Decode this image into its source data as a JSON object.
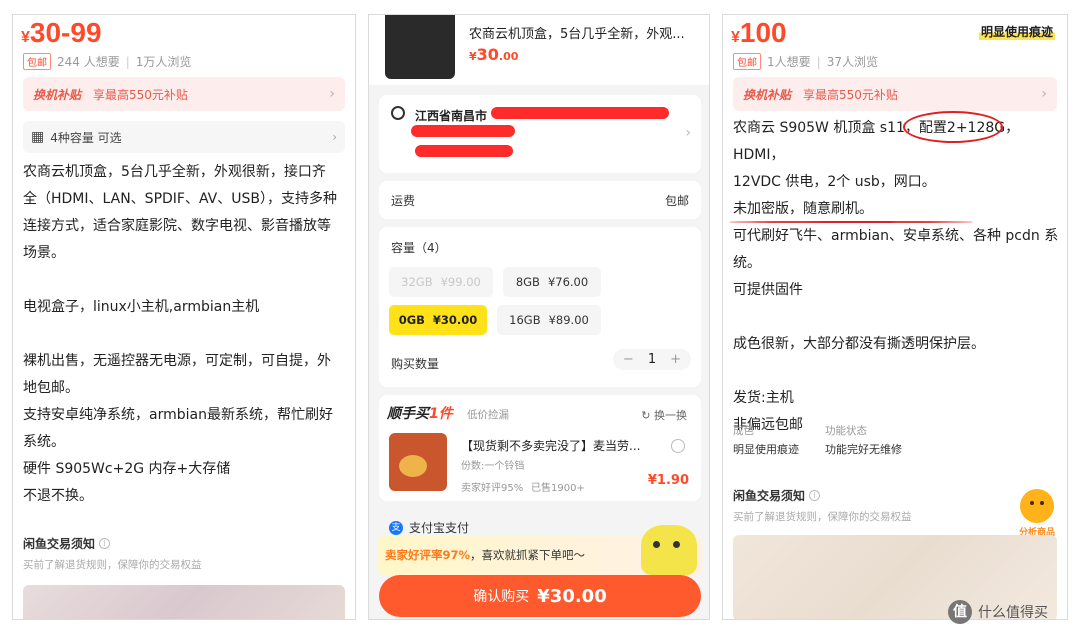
{
  "left": {
    "price_currency": "¥",
    "price_value": "30-99",
    "tag": "包邮",
    "wants": "244 人想要",
    "views": "1万人浏览",
    "subsidy_label": "换机补贴",
    "subsidy_text": "享最高550元补贴",
    "capacity_text": "4种容量 可选",
    "description": [
      "农商云机顶盒，5台几乎全新，外观很新，接口齐",
      "全（HDMI、LAN、SPDIF、AV、USB），支持多种",
      "连接方式，适合家庭影院、数字电视、影音播放等",
      "场景。",
      "",
      "电视盒子，linux小主机,armbian主机",
      "",
      "裸机出售，无遥控器无电源，可定制，可自提，外",
      "地包邮。",
      "支持安卓纯净系统，armbian最新系统，帮忙刷好",
      "系统。",
      "硬件 S905Wc+2G 内存+大存储",
      "不退不换。"
    ],
    "notice_title": "闲鱼交易须知",
    "notice_sub": "买前了解退货规则，保障你的交易权益"
  },
  "middle": {
    "item_title": "农商云机顶盒，5台几乎全新，外观...",
    "item_price_cur": "¥",
    "item_price": "30",
    "item_price_dec": ".00",
    "address": "江西省南昌市",
    "shipping_label": "运费",
    "shipping_value": "包邮",
    "capacity_label": "容量（4）",
    "options": [
      {
        "size": "32GB",
        "price": "¥99.00"
      },
      {
        "size": "8GB",
        "price": "¥76.00"
      },
      {
        "size": "0GB",
        "price": "¥30.00"
      },
      {
        "size": "16GB",
        "price": "¥89.00"
      }
    ],
    "qty_label": "购买数量",
    "qty_minus": "−",
    "qty_value": "1",
    "qty_plus": "+",
    "bundle_title_a": "顺手买",
    "bundle_title_b": "1件",
    "bundle_sub": "低价捡漏",
    "swap": "换一换",
    "bundle_item_title": "【现货剩不多卖完没了】麦当劳...",
    "bundle_item_spec": "份数:一个铃铛",
    "bundle_item_rate": "卖家好评95%",
    "bundle_item_sold": "已售1900+",
    "bundle_item_price": "¥1.90",
    "alipay": "支付宝支付",
    "banner_hl": "卖家好评率97%",
    "banner_rest": "，喜欢就抓紧下单吧～",
    "cta_label": "确认购买",
    "cta_price": "¥30.00"
  },
  "right": {
    "price_currency": "¥",
    "price_value": "100",
    "wear_badge": "明显使用痕迹",
    "tag": "包邮",
    "wants": "1人想要",
    "views": "37人浏览",
    "subsidy_label": "换机补贴",
    "subsidy_text": "享最高550元补贴",
    "description": [
      "农商云 S905W 机顶盒 s11，配置2+128G，HDMI，",
      "12VDC 供电，2个 usb，网口。",
      "未加密版，随意刷机。",
      "可代刷好飞牛、armbian、安卓系统、各种 pcdn 系",
      "统。",
      "可提供固件",
      "",
      "成色很新，大部分都没有撕透明保护层。",
      "",
      "发货:主机",
      "非偏远包邮"
    ],
    "attr_k1": "成色",
    "attr_v1": "明显使用痕迹",
    "attr_k2": "功能状态",
    "attr_v2": "功能完好无维修",
    "notice_title": "闲鱼交易须知",
    "notice_sub": "买前了解退货规则，保障你的交易权益",
    "analyze_label": "分析商品"
  },
  "watermark": {
    "logo_char": "值",
    "text": "什么值得买"
  }
}
